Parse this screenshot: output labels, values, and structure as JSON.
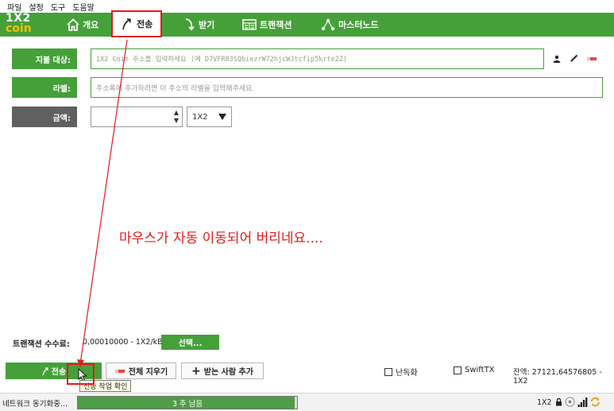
{
  "menubar": {
    "items": [
      "파일",
      "설정",
      "도구",
      "도움말"
    ]
  },
  "brand": {
    "line1": "1X2",
    "line2": "coin"
  },
  "tabs": [
    {
      "label": "개요",
      "icon": "home-icon"
    },
    {
      "label": "전송",
      "icon": "send-arrow-icon",
      "active": true
    },
    {
      "label": "받기",
      "icon": "receive-arrow-icon"
    },
    {
      "label": "트랜잭션",
      "icon": "transactions-icon"
    },
    {
      "label": "마스터노드",
      "icon": "masternode-icon"
    }
  ],
  "form": {
    "payto_label": "지불 대상:",
    "payto_placeholder": "1X2 Coin 주소를 입력하세요 (예 D7VFR83SQbiezrW72hjcWJtcfip5krte2Z)",
    "label_label": "라벨:",
    "label_placeholder": "주소록에 추가하려면 이 주소의 라벨을 입력해주세요.",
    "amount_label": "금액:",
    "unit": "1X2",
    "address_icons": [
      "address-book-icon",
      "edit-icon",
      "clear-icon"
    ]
  },
  "annotation": "마우스가 자동 이동되어 버리네요....",
  "fee": {
    "label": "트랜잭션 수수료:",
    "value": "0,00010000 - 1X2/kB",
    "button": "선택..."
  },
  "actions": {
    "send": "전송",
    "clear_all": "전체 지우기",
    "add_recipient": "받는 사람 추가",
    "tooltip": "전송 작업 확인"
  },
  "options": {
    "darksend": "난독화",
    "swifttx": "SwiftTX"
  },
  "balance": "잔액: 27121,64576805 - 1X2",
  "status": {
    "sync": "네트워크 동기화중...",
    "progress_text": "3 주 남음",
    "progress": 0.99,
    "unit": "1X2"
  },
  "colors": {
    "accent": "#45a03a",
    "highlight": "#e11b1b",
    "gray": "#606060"
  }
}
